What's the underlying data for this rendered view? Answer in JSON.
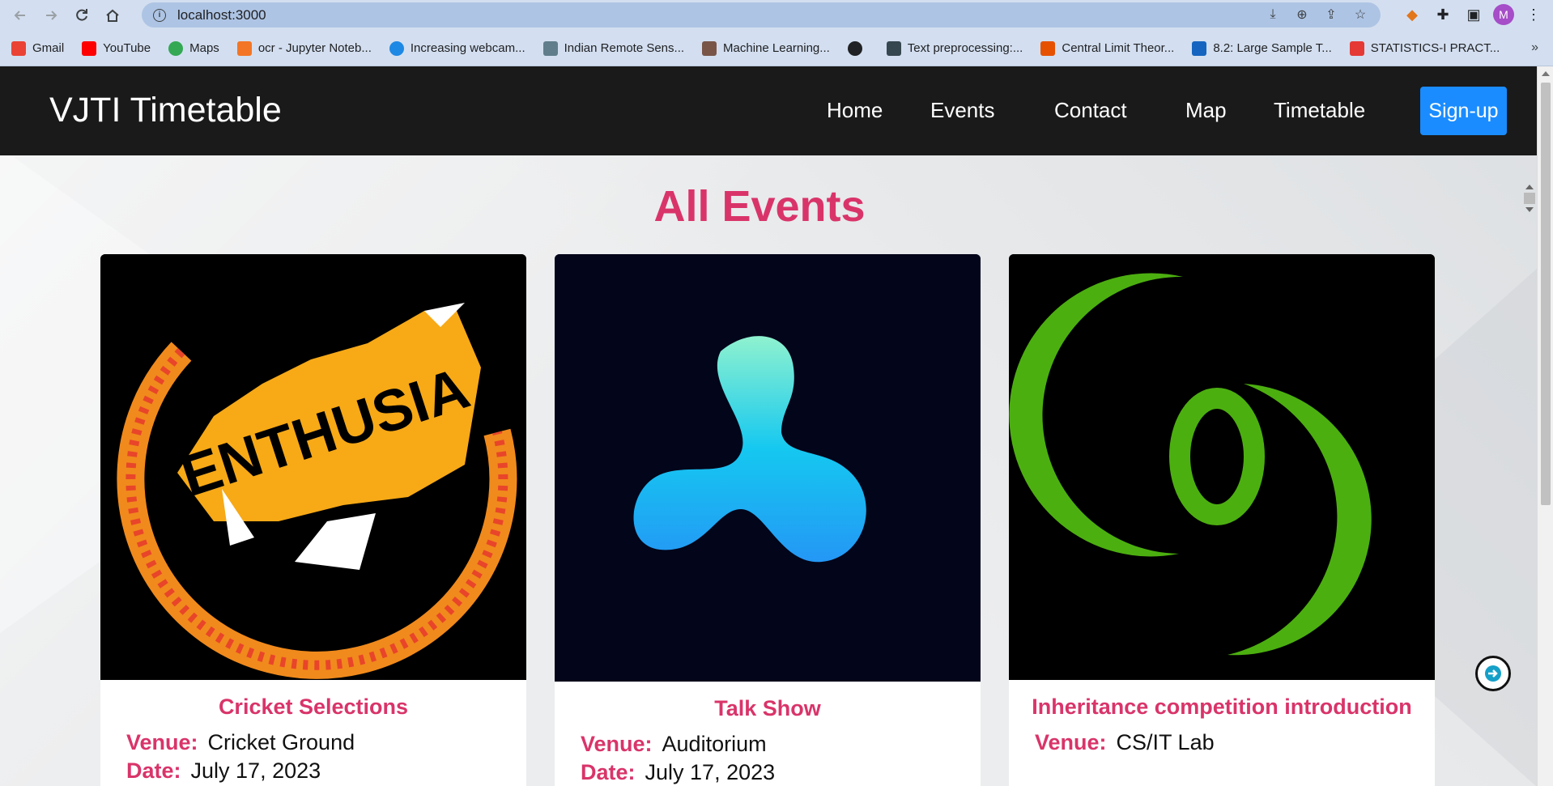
{
  "browser": {
    "url": "localhost:3000",
    "bookmarks": [
      {
        "label": "Gmail",
        "color": "#ea4335"
      },
      {
        "label": "YouTube",
        "color": "#ff0000"
      },
      {
        "label": "Maps",
        "color": "#34a853"
      },
      {
        "label": "ocr - Jupyter Noteb...",
        "color": "#f37626"
      },
      {
        "label": "Increasing webcam...",
        "color": "#1e88e5"
      },
      {
        "label": "Indian Remote Sens...",
        "color": "#607d8b"
      },
      {
        "label": "Machine Learning...",
        "color": "#795548"
      },
      {
        "label": "",
        "color": "#202124"
      },
      {
        "label": "Text preprocessing:...",
        "color": "#37474f"
      },
      {
        "label": "Central Limit Theor...",
        "color": "#e65100"
      },
      {
        "label": "8.2: Large Sample T...",
        "color": "#1565c0"
      },
      {
        "label": "STATISTICS-I PRACT...",
        "color": "#e53935"
      }
    ],
    "avatar_letter": "M"
  },
  "site": {
    "brand": "VJTI Timetable",
    "nav": [
      "Home",
      "Events",
      "Contact",
      "Map",
      "Timetable"
    ],
    "signup": "Sign-up",
    "section_title": "All Events"
  },
  "events": [
    {
      "title": "Cricket Selections",
      "venue_label": "Venue:",
      "venue": "Cricket Ground",
      "date_label": "Date:",
      "date": "July 17, 2023",
      "image": "enthusia-logo"
    },
    {
      "title": "Talk Show",
      "venue_label": "Venue:",
      "venue": "Auditorium",
      "date_label": "Date:",
      "date": "July 17, 2023",
      "image": "blue-blob-logo"
    },
    {
      "title": "Inheritance competition introduction",
      "venue_label": "Venue:",
      "venue": "CS/IT Lab",
      "date_label": "",
      "date": "",
      "image": "green-o-logo"
    }
  ],
  "colors": {
    "accent": "#d9346a",
    "header": "#1a1a1a",
    "signup": "#1a8cff"
  }
}
